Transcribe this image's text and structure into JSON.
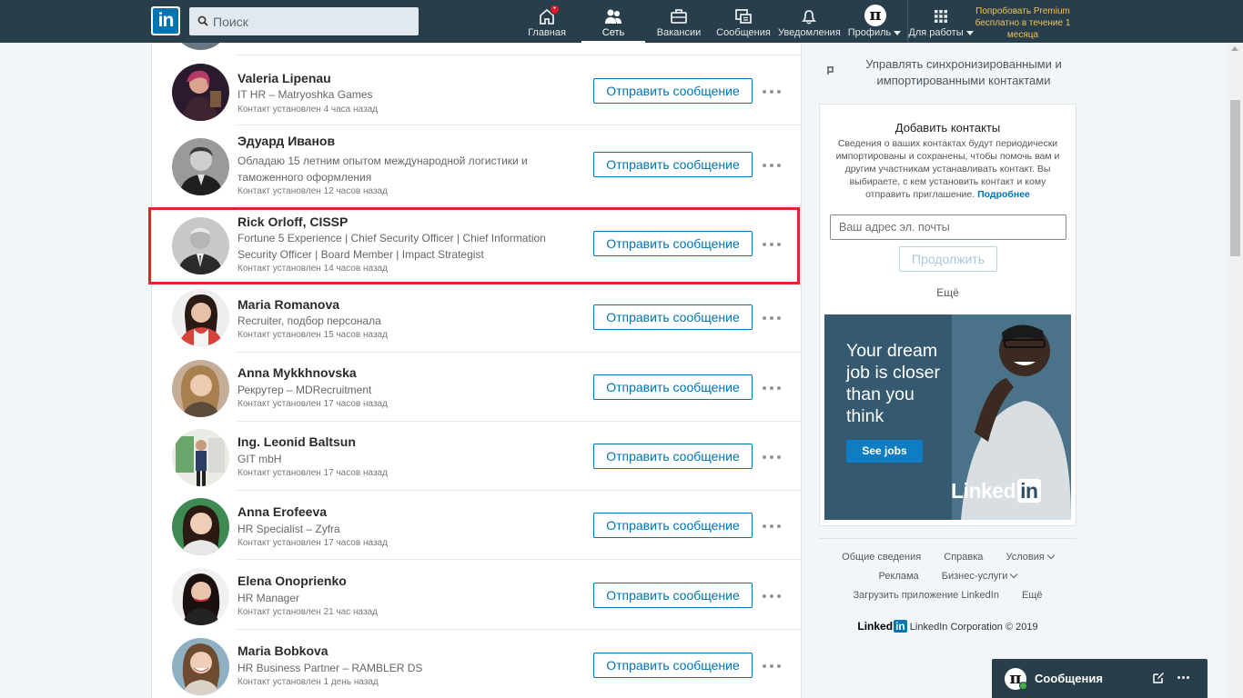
{
  "nav": {
    "search_placeholder": "Поиск",
    "items": [
      {
        "label": "Главная",
        "icon": "home-icon",
        "badge": "•"
      },
      {
        "label": "Сеть",
        "icon": "network-icon"
      },
      {
        "label": "Вакансии",
        "icon": "briefcase-icon"
      },
      {
        "label": "Сообщения",
        "icon": "messaging-icon"
      },
      {
        "label": "Уведомления",
        "icon": "bell-icon"
      },
      {
        "label": "Профиль",
        "icon": "profile-avatar"
      },
      {
        "label": "Для работы",
        "icon": "grid-icon"
      }
    ],
    "logo_text": "in",
    "premium": "Попробовать Premium бесплатно в течение 1 месяца",
    "avatar_glyph": "π"
  },
  "connections": [
    {
      "name": "Valeria Lipenau",
      "title": "IT HR – Matryoshka Games",
      "time": "Контакт установлен 4 часа назад"
    },
    {
      "name": "Эдуард Иванов",
      "title": "Обладаю 15 летним опытом международной логистики и таможенного оформления",
      "time": "Контакт установлен 12 часов назад"
    },
    {
      "name": "Rick Orloff, CISSP",
      "title": "Fortune 5 Experience | Chief Security Officer | Chief Information Security Officer | Board Member | Impact Strategist",
      "time": "Контакт установлен 14 часов назад"
    },
    {
      "name": "Maria Romanova",
      "title": "Recruiter, подбор персонала",
      "time": "Контакт установлен 15 часов назад"
    },
    {
      "name": "Anna Mykkhnovska",
      "title": "Рекрутер – MDRecruitment",
      "time": "Контакт установлен 17 часов назад"
    },
    {
      "name": "Ing. Leonid Baltsun",
      "title": "GIT mbH",
      "time": "Контакт установлен 17 часов назад"
    },
    {
      "name": "Anna Erofeeva",
      "title": "HR Specialist – Zyfra",
      "time": "Контакт установлен 17 часов назад"
    },
    {
      "name": "Elena Onoprienko",
      "title": "HR Manager",
      "time": "Контакт установлен 21 час назад"
    },
    {
      "name": "Maria Bobkova",
      "title": "HR Business Partner – RAMBLER DS",
      "time": "Контакт установлен 1 день назад"
    }
  ],
  "actions": {
    "message_button": "Отправить сообщение"
  },
  "sidebar": {
    "sync_text": "Управлять синхронизированными и импортированными контактами",
    "add_contacts": {
      "title": "Добавить контакты",
      "description": "Сведения о ваших контактах будут периодически импортированы и сохранены, чтобы помочь вам и другим участникам устанавливать контакт. Вы выбираете, с кем установить контакт и кому отправить приглашение.",
      "learn_more": "Подробнее",
      "email_placeholder": "Ваш адрес эл. почты",
      "continue": "Продолжить",
      "more": "Ещё"
    },
    "ad": {
      "headline": "Your dream job is closer than you think",
      "cta": "See jobs",
      "brand": "Linked",
      "brand_in": "in"
    }
  },
  "footer": {
    "row1": [
      "Общие сведения",
      "Справка",
      "Условия"
    ],
    "row2": [
      "Реклама",
      "Бизнес-услуги"
    ],
    "row3": [
      "Загрузить приложение LinkedIn",
      "Ещё"
    ],
    "brand": "Linked",
    "brand_in": "in",
    "copyright": "LinkedIn Corporation © 2019"
  },
  "messaging": {
    "label": "Сообщения",
    "avatar_glyph": "π"
  },
  "colors": {
    "nav_bg": "#283e4a",
    "accent": "#0073b1",
    "highlight": "#e0252e",
    "premium": "#f0c15c"
  }
}
